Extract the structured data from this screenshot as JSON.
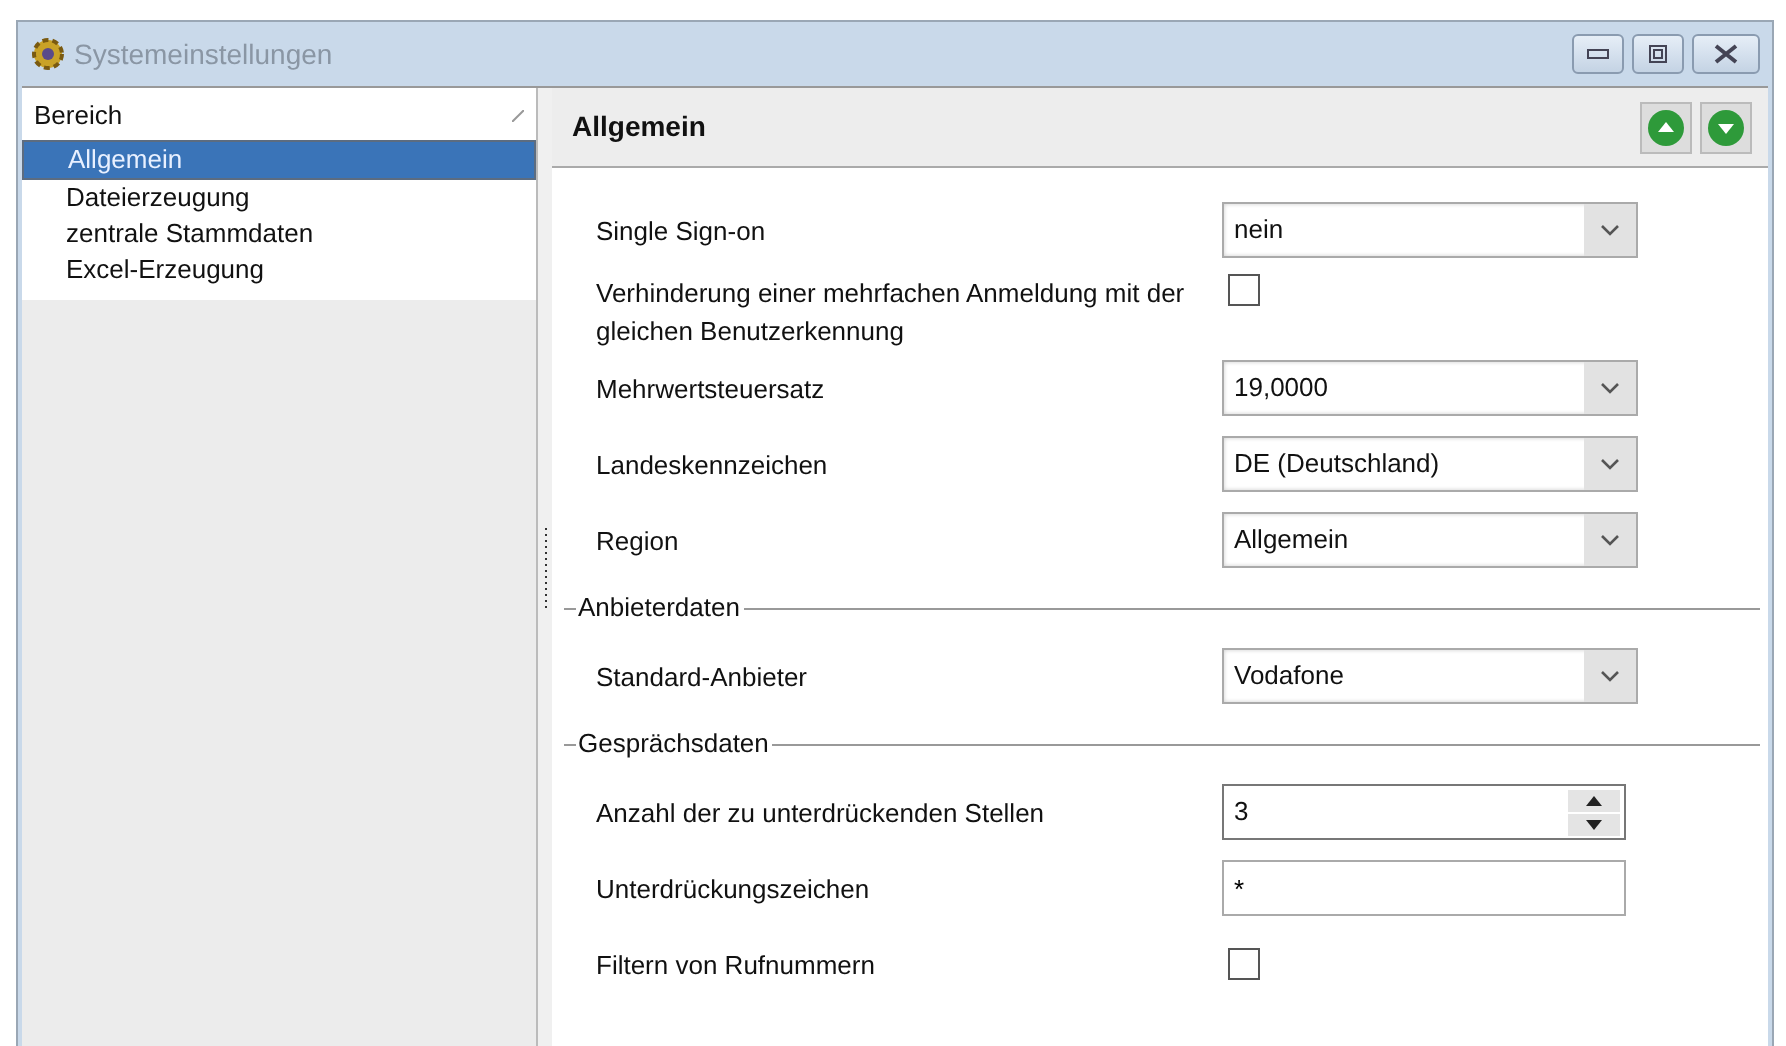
{
  "window": {
    "title": "Systemeinstellungen"
  },
  "sidebar": {
    "header": "Bereich",
    "items": [
      {
        "label": "Allgemein",
        "selected": true
      },
      {
        "label": "Dateierzeugung",
        "selected": false
      },
      {
        "label": "zentrale Stammdaten",
        "selected": false
      },
      {
        "label": "Excel-Erzeugung",
        "selected": false
      }
    ]
  },
  "panel": {
    "title": "Allgemein"
  },
  "settings": [
    {
      "kind": "select",
      "label": "Single Sign-on",
      "value": "nein"
    },
    {
      "kind": "checkbox",
      "label": "Verhinderung einer mehrfachen Anmeldung mit der gleichen Benutzerkennung",
      "checked": false
    },
    {
      "kind": "select",
      "label": "Mehrwertsteuersatz",
      "value": "19,0000"
    },
    {
      "kind": "select",
      "label": "Landeskennzeichen",
      "value": "DE (Deutschland)"
    },
    {
      "kind": "select",
      "label": "Region",
      "value": "Allgemein"
    },
    {
      "kind": "section",
      "label": "Anbieterdaten"
    },
    {
      "kind": "select",
      "label": "Standard-Anbieter",
      "value": "Vodafone"
    },
    {
      "kind": "section",
      "label": "Gesprächsdaten"
    },
    {
      "kind": "spinner",
      "label": "Anzahl der zu unterdrückenden Stellen",
      "value": "3"
    },
    {
      "kind": "text",
      "label": "Unterdrückungszeichen",
      "value": "*"
    },
    {
      "kind": "checkbox",
      "label": "Filtern von Rufnummern",
      "checked": false
    }
  ]
}
